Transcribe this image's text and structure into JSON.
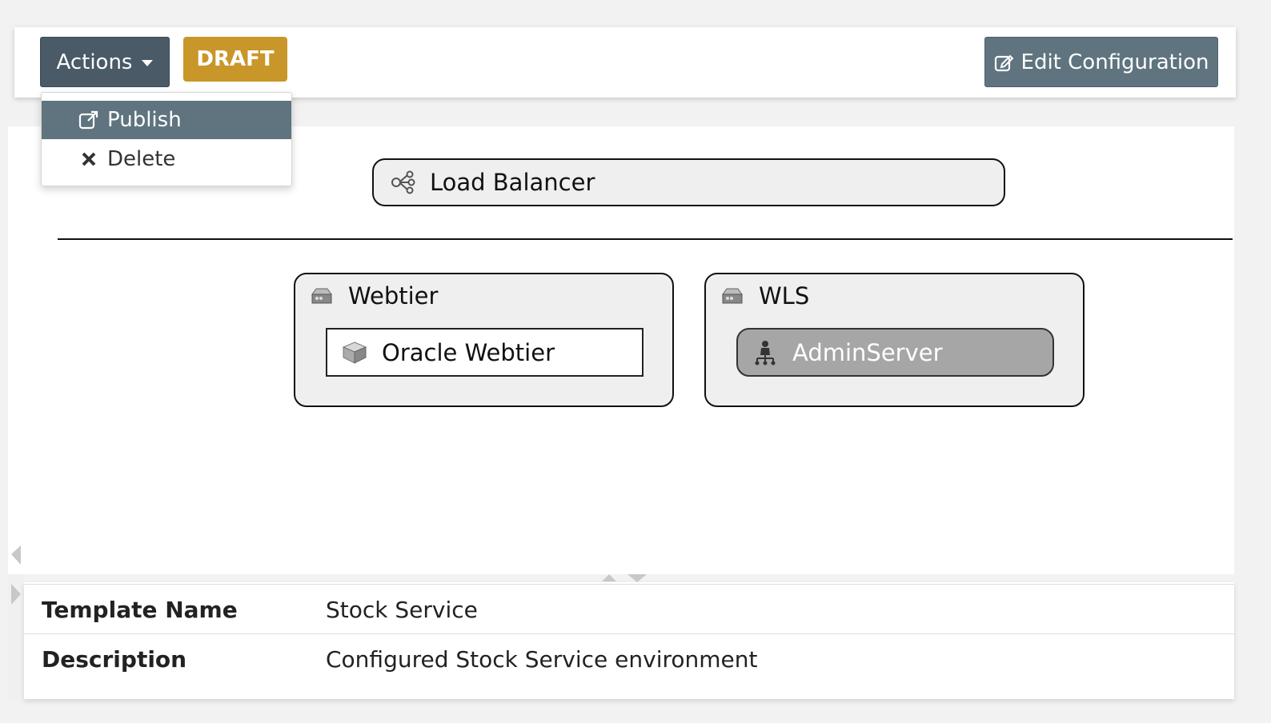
{
  "toolbar": {
    "actions_label": "Actions",
    "status_badge": "DRAFT",
    "edit_label": "Edit Configuration"
  },
  "actions_menu": {
    "items": [
      {
        "label": "Publish",
        "icon": "external-link-icon"
      },
      {
        "label": "Delete",
        "icon": "close-icon"
      }
    ]
  },
  "topology": {
    "load_balancer": {
      "label": "Load Balancer",
      "icon": "share-network-icon"
    },
    "tiers": [
      {
        "title": "Webtier",
        "icon": "server-icon",
        "component": {
          "label": "Oracle Webtier",
          "icon": "cube-icon"
        }
      },
      {
        "title": "WLS",
        "icon": "server-icon",
        "component": {
          "label": "AdminServer",
          "icon": "admin-server-icon"
        }
      }
    ]
  },
  "details": {
    "rows": [
      {
        "key": "Template Name",
        "value": "Stock Service"
      },
      {
        "key": "Description",
        "value": "Configured Stock Service environment"
      }
    ]
  },
  "colors": {
    "primary_button": "#4a5a66",
    "secondary_button": "#5f747f",
    "draft_badge": "#c9962a",
    "admin_server_fill": "#a6a6a6"
  }
}
